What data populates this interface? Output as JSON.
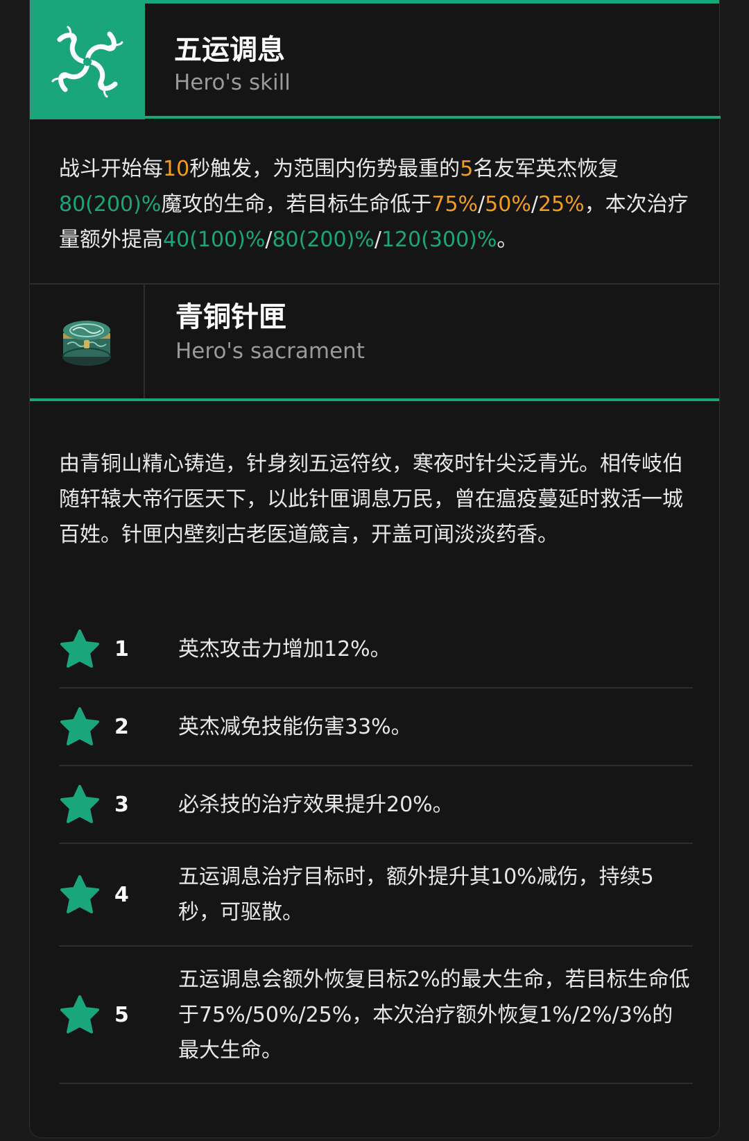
{
  "skill": {
    "title": "五运调息",
    "subtitle": "Hero's skill",
    "icon": "swirl-wind-icon",
    "description_parts": [
      {
        "t": "战斗开始每",
        "c": "n"
      },
      {
        "t": "10",
        "c": "o"
      },
      {
        "t": "秒触发，为范围内伤势最重的",
        "c": "n"
      },
      {
        "t": "5",
        "c": "o"
      },
      {
        "t": "名友军英杰恢复",
        "c": "n"
      },
      {
        "t": "80(200)%",
        "c": "g"
      },
      {
        "t": "魔攻的生命，若目标生命低于",
        "c": "n"
      },
      {
        "t": "75%",
        "c": "o"
      },
      {
        "t": "/",
        "c": "n"
      },
      {
        "t": "50%",
        "c": "o"
      },
      {
        "t": "/",
        "c": "n"
      },
      {
        "t": "25%",
        "c": "o"
      },
      {
        "t": "，本次治疗量额外提高",
        "c": "n"
      },
      {
        "t": "40(100)%",
        "c": "g"
      },
      {
        "t": "/",
        "c": "n"
      },
      {
        "t": "80(200)%",
        "c": "g"
      },
      {
        "t": "/",
        "c": "n"
      },
      {
        "t": "120(300)%",
        "c": "g"
      },
      {
        "t": "。",
        "c": "n"
      }
    ]
  },
  "sacrament": {
    "title": "青铜针匣",
    "subtitle": "Hero's sacrament",
    "icon": "bronze-box-icon",
    "description": "由青铜山精心铸造，针身刻五运符纹，寒夜时针尖泛青光。相传岐伯随轩辕大帝行医天下，以此针匣调息万民，曾在瘟疫蔓延时救活一城百姓。针匣内壁刻古老医道箴言，开盖可闻淡淡药香。"
  },
  "perks": [
    {
      "level": "1",
      "text": "英杰攻击力增加12%。"
    },
    {
      "level": "2",
      "text": "英杰减免技能伤害33%。"
    },
    {
      "level": "3",
      "text": "必杀技的治疗效果提升20%。"
    },
    {
      "level": "4",
      "text": "五运调息治疗目标时，额外提升其10%减伤，持续5秒，可驱散。"
    },
    {
      "level": "5",
      "text": "五运调息会额外恢复目标2%的最大生命，若目标生命低于75%/50%/25%，本次治疗额外恢复1%/2%/3%的最大生命。"
    }
  ],
  "colors": {
    "accent": "#1aa67a",
    "highlight_orange": "#f39c1f",
    "background": "#151515"
  }
}
